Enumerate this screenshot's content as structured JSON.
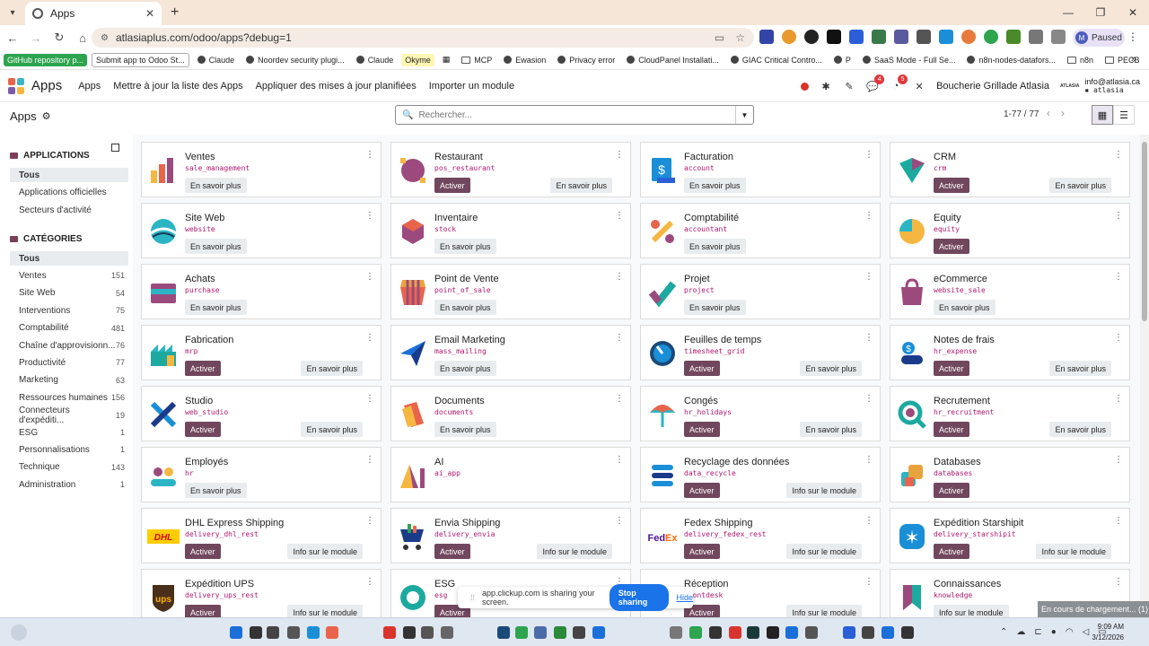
{
  "browser": {
    "tab_title": "Apps",
    "url": "atlasiaplus.com/odoo/apps?debug=1",
    "profile_status": "Paused",
    "profile_initial": "M",
    "bookmarks": [
      {
        "label": "GitHub repository p...",
        "style": "green"
      },
      {
        "label": "Submit app to Odoo St...",
        "style": "boxed"
      },
      {
        "label": "Claude",
        "style": "plain"
      },
      {
        "label": "Noordev security plugi...",
        "style": "plain"
      },
      {
        "label": "Claude",
        "style": "plain"
      },
      {
        "label": "Okyme",
        "style": "yellow"
      },
      {
        "label": "MCP",
        "style": "folder"
      },
      {
        "label": "Ewasion",
        "style": "plain"
      },
      {
        "label": "Privacy error",
        "style": "plain"
      },
      {
        "label": "CloudPanel Installati...",
        "style": "plain"
      },
      {
        "label": "GIAC Critical Contro...",
        "style": "plain"
      },
      {
        "label": "P",
        "style": "plain"
      },
      {
        "label": "SaaS Mode - Full Se...",
        "style": "plain"
      },
      {
        "label": "n8n-nodes-datafors...",
        "style": "plain"
      },
      {
        "label": "n8n",
        "style": "folder"
      },
      {
        "label": "PECB",
        "style": "folder"
      }
    ]
  },
  "navbar": {
    "brand": "Apps",
    "menu": [
      "Apps",
      "Mettre à jour la liste des Apps",
      "Appliquer des mises à jour planifiées",
      "Importer un module"
    ],
    "chat_badge": "4",
    "activity_badge": "5",
    "company": "Boucherie Grillade Atlasia",
    "user_email": "info@atlasia.ca",
    "user_db": "atlasia",
    "logo_text": "ATLASIA"
  },
  "control_panel": {
    "title": "Apps",
    "search_placeholder": "Rechercher...",
    "pager": "1-77 / 77"
  },
  "sidebar": {
    "applications_header": "APPLICATIONS",
    "applications": [
      {
        "label": "Tous",
        "active": true
      },
      {
        "label": "Applications officielles",
        "active": false
      },
      {
        "label": "Secteurs d'activité",
        "active": false
      }
    ],
    "categories_header": "CATÉGORIES",
    "categories": [
      {
        "label": "Tous",
        "count": "",
        "active": true
      },
      {
        "label": "Ventes",
        "count": "151"
      },
      {
        "label": "Site Web",
        "count": "54"
      },
      {
        "label": "Interventions",
        "count": "75"
      },
      {
        "label": "Comptabilité",
        "count": "481"
      },
      {
        "label": "Chaîne d'approvisionn...",
        "count": "76"
      },
      {
        "label": "Productivité",
        "count": "77"
      },
      {
        "label": "Marketing",
        "count": "63"
      },
      {
        "label": "Ressources humaines",
        "count": "156"
      },
      {
        "label": "Connecteurs d'expéditi...",
        "count": "19"
      },
      {
        "label": "ESG",
        "count": "1"
      },
      {
        "label": "Personnalisations",
        "count": "1"
      },
      {
        "label": "Technique",
        "count": "143"
      },
      {
        "label": "Administration",
        "count": "1"
      }
    ]
  },
  "apps": [
    {
      "name": "Ventes",
      "tech": "sale_management",
      "activate": "",
      "secondary": "En savoir plus",
      "icon": "sales-icon",
      "color": "#e8654b"
    },
    {
      "name": "Restaurant",
      "tech": "pos_restaurant",
      "activate": "Activer",
      "secondary": "En savoir plus",
      "icon": "restaurant-icon",
      "color": "#9c4a7e"
    },
    {
      "name": "Facturation",
      "tech": "account",
      "activate": "",
      "secondary": "En savoir plus",
      "icon": "invoicing-icon",
      "color": "#1a8fd8"
    },
    {
      "name": "CRM",
      "tech": "crm",
      "activate": "Activer",
      "secondary": "En savoir plus",
      "icon": "crm-icon",
      "color": "#1ca9a0"
    },
    {
      "name": "Site Web",
      "tech": "website",
      "activate": "",
      "secondary": "En savoir plus",
      "icon": "website-icon",
      "color": "#2bb5c4"
    },
    {
      "name": "Inventaire",
      "tech": "stock",
      "activate": "",
      "secondary": "En savoir plus",
      "icon": "inventory-icon",
      "color": "#9c4a7e"
    },
    {
      "name": "Comptabilité",
      "tech": "accountant",
      "activate": "",
      "secondary": "En savoir plus",
      "icon": "accounting-icon",
      "color": "#e8654b"
    },
    {
      "name": "Equity",
      "tech": "equity",
      "activate": "Activer",
      "secondary": "",
      "icon": "equity-icon",
      "color": "#2bb5c4"
    },
    {
      "name": "Achats",
      "tech": "purchase",
      "activate": "",
      "secondary": "En savoir plus",
      "icon": "purchase-icon",
      "color": "#9c4a7e"
    },
    {
      "name": "Point de Vente",
      "tech": "point_of_sale",
      "activate": "",
      "secondary": "En savoir plus",
      "icon": "pos-icon",
      "color": "#e8a33c"
    },
    {
      "name": "Projet",
      "tech": "project",
      "activate": "",
      "secondary": "En savoir plus",
      "icon": "project-icon",
      "color": "#1ca9a0"
    },
    {
      "name": "eCommerce",
      "tech": "website_sale",
      "activate": "",
      "secondary": "En savoir plus",
      "icon": "ecommerce-icon",
      "color": "#9c4a7e"
    },
    {
      "name": "Fabrication",
      "tech": "mrp",
      "activate": "Activer",
      "secondary": "En savoir plus",
      "icon": "manufacturing-icon",
      "color": "#1ca9a0"
    },
    {
      "name": "Email Marketing",
      "tech": "mass_mailing",
      "activate": "",
      "secondary": "En savoir plus",
      "icon": "email-marketing-icon",
      "color": "#1a6fd8"
    },
    {
      "name": "Feuilles de temps",
      "tech": "timesheet_grid",
      "activate": "Activer",
      "secondary": "En savoir plus",
      "icon": "timesheet-icon",
      "color": "#1a8fd8"
    },
    {
      "name": "Notes de frais",
      "tech": "hr_expense",
      "activate": "Activer",
      "secondary": "En savoir plus",
      "icon": "expense-icon",
      "color": "#1a8fd8"
    },
    {
      "name": "Studio",
      "tech": "web_studio",
      "activate": "Activer",
      "secondary": "En savoir plus",
      "icon": "studio-icon",
      "color": "#1a8fd8"
    },
    {
      "name": "Documents",
      "tech": "documents",
      "activate": "",
      "secondary": "En savoir plus",
      "icon": "documents-icon",
      "color": "#e8654b"
    },
    {
      "name": "Congés",
      "tech": "hr_holidays",
      "activate": "Activer",
      "secondary": "En savoir plus",
      "icon": "time-off-icon",
      "color": "#2bb5c4"
    },
    {
      "name": "Recrutement",
      "tech": "hr_recruitment",
      "activate": "Activer",
      "secondary": "En savoir plus",
      "icon": "recruitment-icon",
      "color": "#1ca9a0"
    },
    {
      "name": "Employés",
      "tech": "hr",
      "activate": "",
      "secondary": "En savoir plus",
      "icon": "employees-icon",
      "color": "#9c4a7e"
    },
    {
      "name": "AI",
      "tech": "ai_app",
      "activate": "",
      "secondary": "",
      "icon": "ai-icon",
      "color": "#9c4a7e"
    },
    {
      "name": "Recyclage des données",
      "tech": "data_recycle",
      "activate": "Activer",
      "secondary": "Info sur le module",
      "icon": "data-recycle-icon",
      "color": "#1a8fd8"
    },
    {
      "name": "Databases",
      "tech": "databases",
      "activate": "Activer",
      "secondary": "",
      "icon": "databases-icon",
      "color": "#e8a33c"
    },
    {
      "name": "DHL Express Shipping",
      "tech": "delivery_dhl_rest",
      "activate": "Activer",
      "secondary": "Info sur le module",
      "icon": "dhl-icon",
      "color": "#ffcc00"
    },
    {
      "name": "Envia Shipping",
      "tech": "delivery_envia",
      "activate": "Activer",
      "secondary": "Info sur le module",
      "icon": "envia-icon",
      "color": "#2da44e"
    },
    {
      "name": "Fedex Shipping",
      "tech": "delivery_fedex_rest",
      "activate": "Activer",
      "secondary": "Info sur le module",
      "icon": "fedex-icon",
      "color": "#4d148c"
    },
    {
      "name": "Expédition Starshipit",
      "tech": "delivery_starshipit",
      "activate": "Activer",
      "secondary": "Info sur le module",
      "icon": "starshipit-icon",
      "color": "#1a8fd8"
    },
    {
      "name": "Expédition UPS",
      "tech": "delivery_ups_rest",
      "activate": "Activer",
      "secondary": "Info sur le module",
      "icon": "ups-icon",
      "color": "#4a2f1a"
    },
    {
      "name": "ESG",
      "tech": "esg",
      "activate": "Activer",
      "secondary": "",
      "icon": "esg-icon",
      "color": "#1ca9a0"
    },
    {
      "name": "Réception",
      "tech": "frontdesk",
      "activate": "Activer",
      "secondary": "Info sur le module",
      "icon": "frontdesk-icon",
      "color": "#e8654b"
    },
    {
      "name": "Connaissances",
      "tech": "knowledge",
      "activate": "",
      "secondary": "Info sur le module",
      "icon": "knowledge-icon",
      "color": "#1ca9a0"
    }
  ],
  "screen_share": {
    "text": "app.clickup.com is sharing your screen.",
    "stop": "Stop sharing",
    "hide": "Hide"
  },
  "loading_text": "En cours de chargement... (1)",
  "taskbar": {
    "time": "9:09 AM",
    "date": "3/12/2026"
  }
}
